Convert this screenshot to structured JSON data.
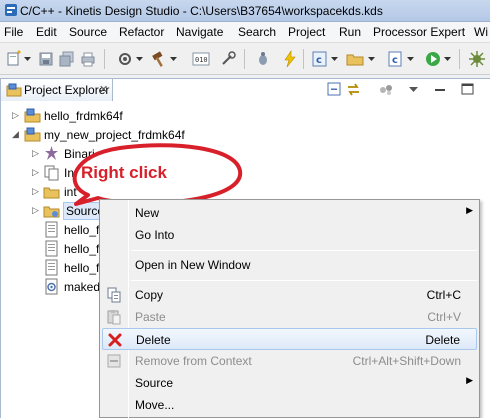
{
  "window": {
    "title": "C/C++ - Kinetis Design Studio - C:\\Users\\B37654\\workspacekds.kds"
  },
  "menu": [
    "File",
    "Edit",
    "Source",
    "Refactor",
    "Navigate",
    "Search",
    "Project",
    "Run",
    "Processor Expert",
    "Wi"
  ],
  "toolbar": {
    "icons": [
      "new-icon",
      "save-icon",
      "save-all-icon",
      "print-icon",
      "settings-icon",
      "build-hammer-icon",
      "binary-010-icon",
      "tools-icon",
      "debug-icon",
      "flash-icon",
      "new-c-class-icon",
      "new-c-file-icon",
      "run-icon",
      "package-icon"
    ]
  },
  "view": {
    "tab_label": "Project Explorer",
    "tab_close": "✕"
  },
  "tree": [
    {
      "label": "hello_frdmk64f",
      "icon": "project-icon",
      "expanded": false
    },
    {
      "label": "my_new_project_frdmk64f",
      "icon": "project-icon",
      "expanded": true
    },
    {
      "label": "Binari",
      "icon": "binaries-icon"
    },
    {
      "label": "In",
      "icon": "includes-icon"
    },
    {
      "label": "int",
      "icon": "folder-icon"
    },
    {
      "label": "Source",
      "icon": "source-folder-icon",
      "selected": true
    },
    {
      "label": "hello_f",
      "icon": "file-icon"
    },
    {
      "label": "hello_f",
      "icon": "file-icon"
    },
    {
      "label": "hello_f",
      "icon": "file-icon"
    },
    {
      "label": "maked",
      "icon": "makefile-icon"
    }
  ],
  "annotation": {
    "text": "Right click",
    "color": "#d8202a"
  },
  "context_menu": {
    "items": [
      {
        "label": "New",
        "shortcut": "",
        "submenu": true
      },
      {
        "label": "Go Into",
        "shortcut": ""
      },
      {
        "label": "Open in New Window",
        "shortcut": ""
      },
      {
        "label": "Copy",
        "shortcut": "Ctrl+C",
        "icon": "copy-icon"
      },
      {
        "label": "Paste",
        "shortcut": "Ctrl+V",
        "icon": "paste-icon",
        "disabled": true
      },
      {
        "label": "Delete",
        "shortcut": "Delete",
        "icon": "delete-icon",
        "hover": true
      },
      {
        "label": "Remove from Context",
        "shortcut": "Ctrl+Alt+Shift+Down",
        "icon": "remove-context-icon",
        "disabled": true
      },
      {
        "label": "Source",
        "shortcut": "",
        "submenu": true
      },
      {
        "label": "Move...",
        "shortcut": ""
      }
    ],
    "arrow": "▶"
  },
  "colors": {
    "selection_hover": "#dde9f8",
    "delete_red": "#d42020",
    "folder_yellow": "#e9c15d"
  }
}
